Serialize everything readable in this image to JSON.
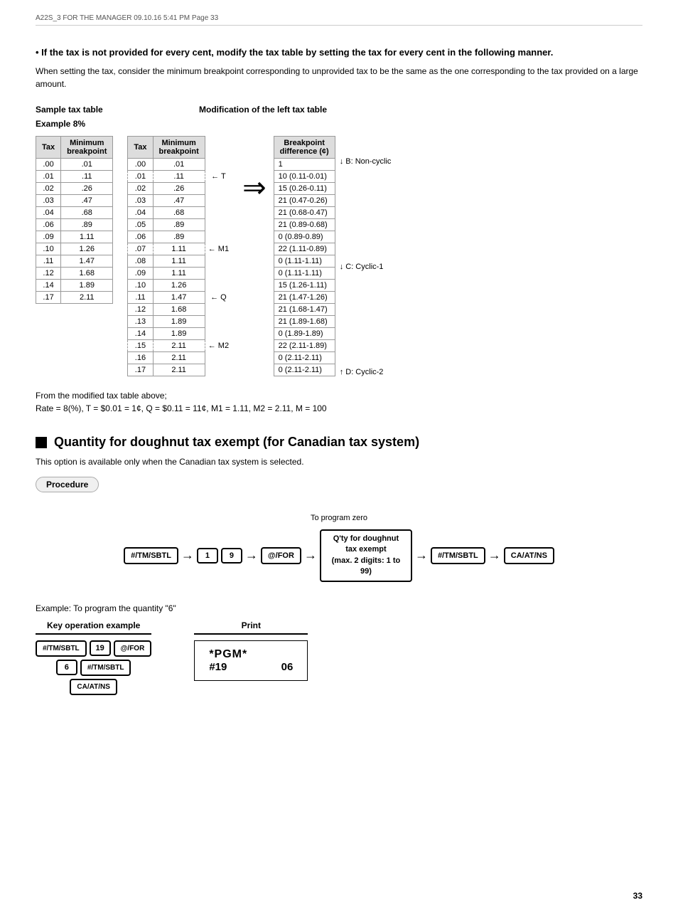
{
  "header": {
    "left": "A22S_3 FOR THE MANAGER  09.10.16 5:41 PM  Page 33",
    "right": ""
  },
  "bullet": {
    "main": "• If the tax is not provided for every cent, modify the tax table by setting the tax for every cent in the following manner.",
    "sub": "When setting the tax, consider the minimum breakpoint corresponding to unprovided tax to be the same as the one corresponding to the tax provided on a large amount."
  },
  "sample_table": {
    "label1": "Sample tax table",
    "label2": "Example 8%",
    "label3": "Modification of the left tax table",
    "headers": [
      "Tax",
      "Minimum breakpoint"
    ],
    "rows": [
      [
        ".00",
        ".01"
      ],
      [
        ".01",
        ".11"
      ],
      [
        ".02",
        ".26"
      ],
      [
        ".03",
        ".47"
      ],
      [
        ".04",
        ".68"
      ],
      [
        ".06",
        ".89"
      ],
      [
        ".09",
        "1.11"
      ],
      [
        ".10",
        "1.26"
      ],
      [
        ".11",
        "1.47"
      ],
      [
        ".12",
        "1.68"
      ],
      [
        ".14",
        "1.89"
      ],
      [
        ".17",
        "2.11"
      ]
    ]
  },
  "modified_table": {
    "headers": [
      "Tax",
      "Minimum breakpoint"
    ],
    "rows": [
      [
        ".00",
        ".01",
        ""
      ],
      [
        ".01",
        ".11",
        "T"
      ],
      [
        ".02",
        ".26",
        ""
      ],
      [
        ".03",
        ".47",
        ""
      ],
      [
        ".04",
        ".68",
        ""
      ],
      [
        ".05",
        ".89",
        ""
      ],
      [
        ".06",
        ".89",
        ""
      ],
      [
        ".07",
        "1.11",
        "M1"
      ],
      [
        ".08",
        "1.11",
        ""
      ],
      [
        ".09",
        "1.11",
        ""
      ],
      [
        ".10",
        "1.26",
        ""
      ],
      [
        ".11",
        "1.47",
        ""
      ],
      [
        ".12",
        "1.68",
        ""
      ],
      [
        ".13",
        "1.89",
        ""
      ],
      [
        ".14",
        "1.89",
        ""
      ],
      [
        ".15",
        "2.11",
        "M2"
      ],
      [
        ".16",
        "2.11",
        ""
      ],
      [
        ".17",
        "2.11",
        ""
      ]
    ]
  },
  "breakpoint_table": {
    "header": "Breakpoint difference (¢)",
    "rows": [
      "1",
      "10 (0.11-0.01)",
      "15 (0.26-0.11)",
      "21 (0.47-0.26)",
      "21 (0.68-0.47)",
      "21 (0.89-0.68)",
      "0 (0.89-0.89)",
      "22 (1.11-0.89)",
      "0 (1.11-1.11)",
      "0 (1.11-1.11)",
      "15 (1.26-1.11)",
      "21 (1.47-1.26)",
      "21 (1.68-1.47)",
      "21 (1.89-1.68)",
      "0 (1.89-1.89)",
      "22 (2.11-1.89)",
      "0 (2.11-2.11)",
      "0 (2.11-2.11)"
    ],
    "labels": [
      "B: Non-cyclic",
      "C: Cyclic-1",
      "D: Cyclic-2"
    ]
  },
  "from_modified": {
    "line1": "From the modified tax table above;",
    "line2": "Rate = 8(%), T = $0.01 = 1¢, Q = $0.11 = 11¢, M1 = 1.11, M2 = 2.11, M = 100"
  },
  "quantity_section": {
    "heading": "Quantity for doughnut tax exempt (for Canadian tax system)",
    "avail": "This option is available only when the Canadian tax system is selected.",
    "procedure": "Procedure"
  },
  "flow": {
    "label_above": "To program zero",
    "keys": [
      "#/TM/SBTL",
      "1",
      "9",
      "@/FOR",
      "Q'ty for doughnut tax exempt (max. 2 digits: 1 to 99)",
      "#/TM/SBTL",
      "CA/AT/NS"
    ]
  },
  "example": {
    "title": "Example:  To program the quantity \"6\"",
    "key_op_title": "Key operation example",
    "print_title": "Print",
    "key_op": {
      "row1_key1": "#/TM/SBTL",
      "row1_key2": "19",
      "row1_key3": "@/FOR",
      "row2_key1": "6",
      "row2_key2": "#/TM/SBTL",
      "row3_key1": "CA/AT/NS"
    },
    "print": {
      "line1": "*PGM*",
      "line2_left": "#19",
      "line2_right": "06"
    }
  },
  "page_number": "33"
}
